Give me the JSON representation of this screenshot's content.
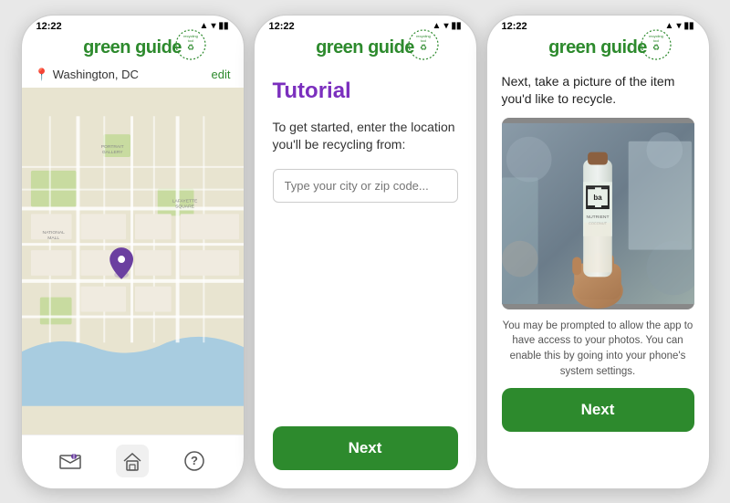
{
  "colors": {
    "green": "#2d8a2d",
    "purple": "#7b2fbe",
    "dark": "#222",
    "gray": "#555"
  },
  "phone1": {
    "status_time": "12:22",
    "app_name": "green guide",
    "location": "Washington, DC",
    "edit_label": "edit",
    "nav_items": [
      "map-icon",
      "home-icon",
      "help-icon"
    ]
  },
  "phone2": {
    "status_time": "12:22",
    "app_name": "green guide",
    "tutorial_title": "Tutorial",
    "tutorial_desc": "To get started, enter the location you'll be recycling from:",
    "input_placeholder": "Type your city or zip code...",
    "next_label": "Next"
  },
  "phone3": {
    "status_time": "12:22",
    "app_name": "green guide",
    "desc_top": "Next, take a picture of the item you'd like to recycle.",
    "desc_bottom": "You may be prompted to allow the app to have access to your photos. You can enable this by going into your phone's system settings.",
    "next_label": "Next"
  }
}
